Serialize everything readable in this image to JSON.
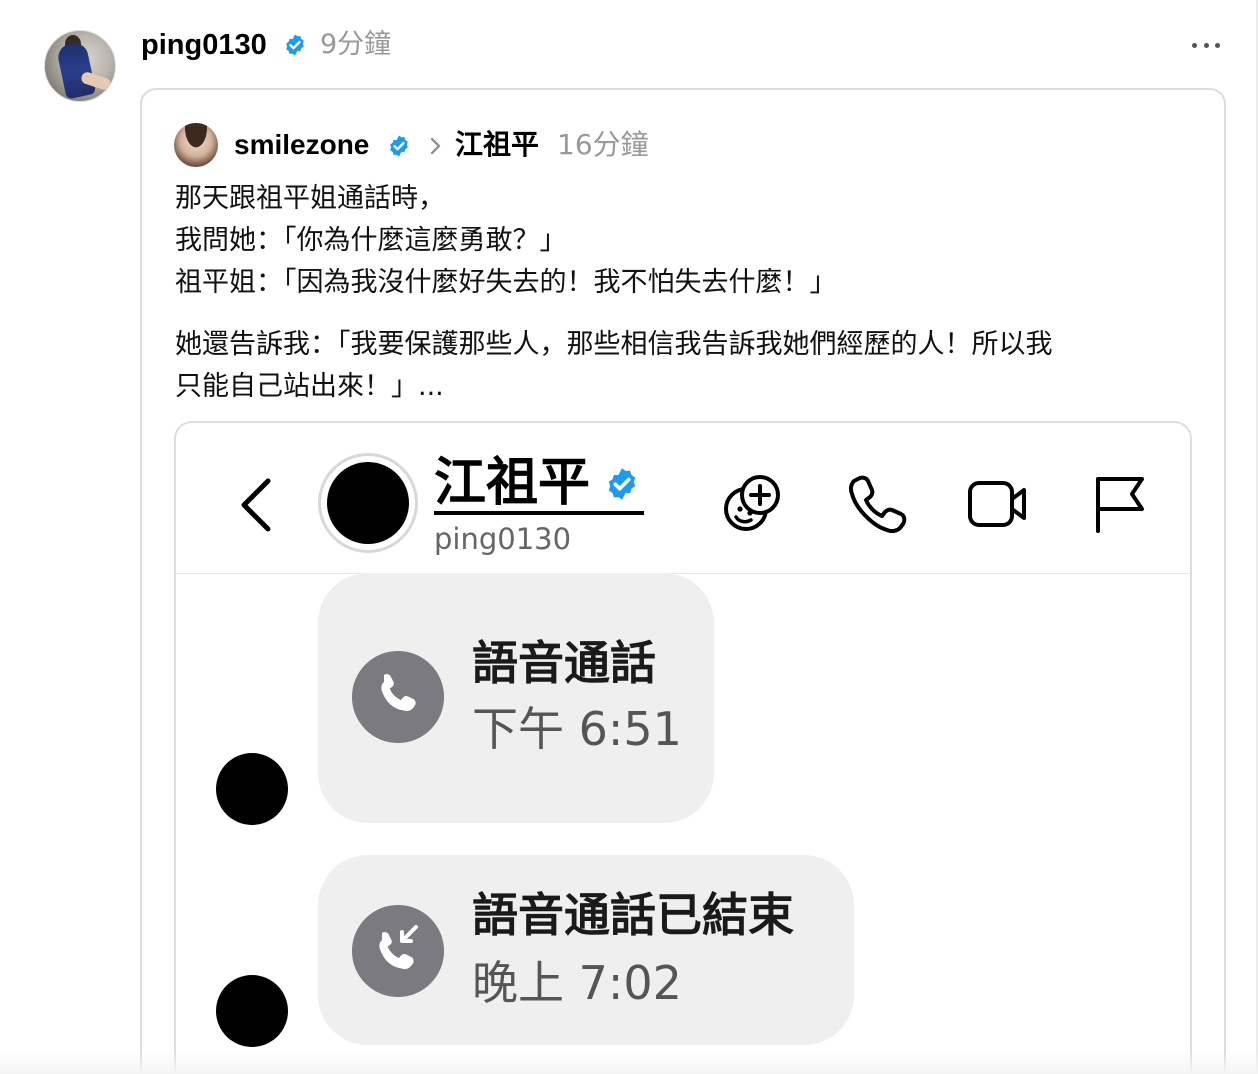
{
  "post": {
    "author": "ping0130",
    "time": "9分鐘"
  },
  "quote": {
    "username": "smilezone",
    "target": "江祖平",
    "time": "16分鐘",
    "lines": [
      "那天跟祖平姐通話時，",
      "我問她：「你為什麼這麼勇敢？」",
      "祖平姐：「因為我沒什麼好失去的！我不怕失去什麼！」"
    ],
    "paragraph2": "她還告訴我：「我要保護那些人，那些相信我告訴我她們經歷的人！所以我\n只能自己站出來！」..."
  },
  "screenshot": {
    "chat_name": "江祖平",
    "chat_handle": "ping0130",
    "messages": [
      {
        "title": "語音通話",
        "time": "下午 6:51"
      },
      {
        "title": "語音通話已結束",
        "time": "晚上 7:02"
      }
    ]
  },
  "icons": {
    "verified": "verified-badge-icon",
    "more": "more-options-icon",
    "chevron": "chevron-right-icon",
    "back": "back-arrow-icon",
    "add_member": "add-emoji-icon",
    "phone": "phone-icon",
    "video": "video-icon",
    "flag": "flag-icon"
  },
  "colors": {
    "verified_blue": "#1d9bf0",
    "muted_text": "#999999",
    "bubble_bg": "#efefef",
    "call_circle": "#7a7a80"
  }
}
